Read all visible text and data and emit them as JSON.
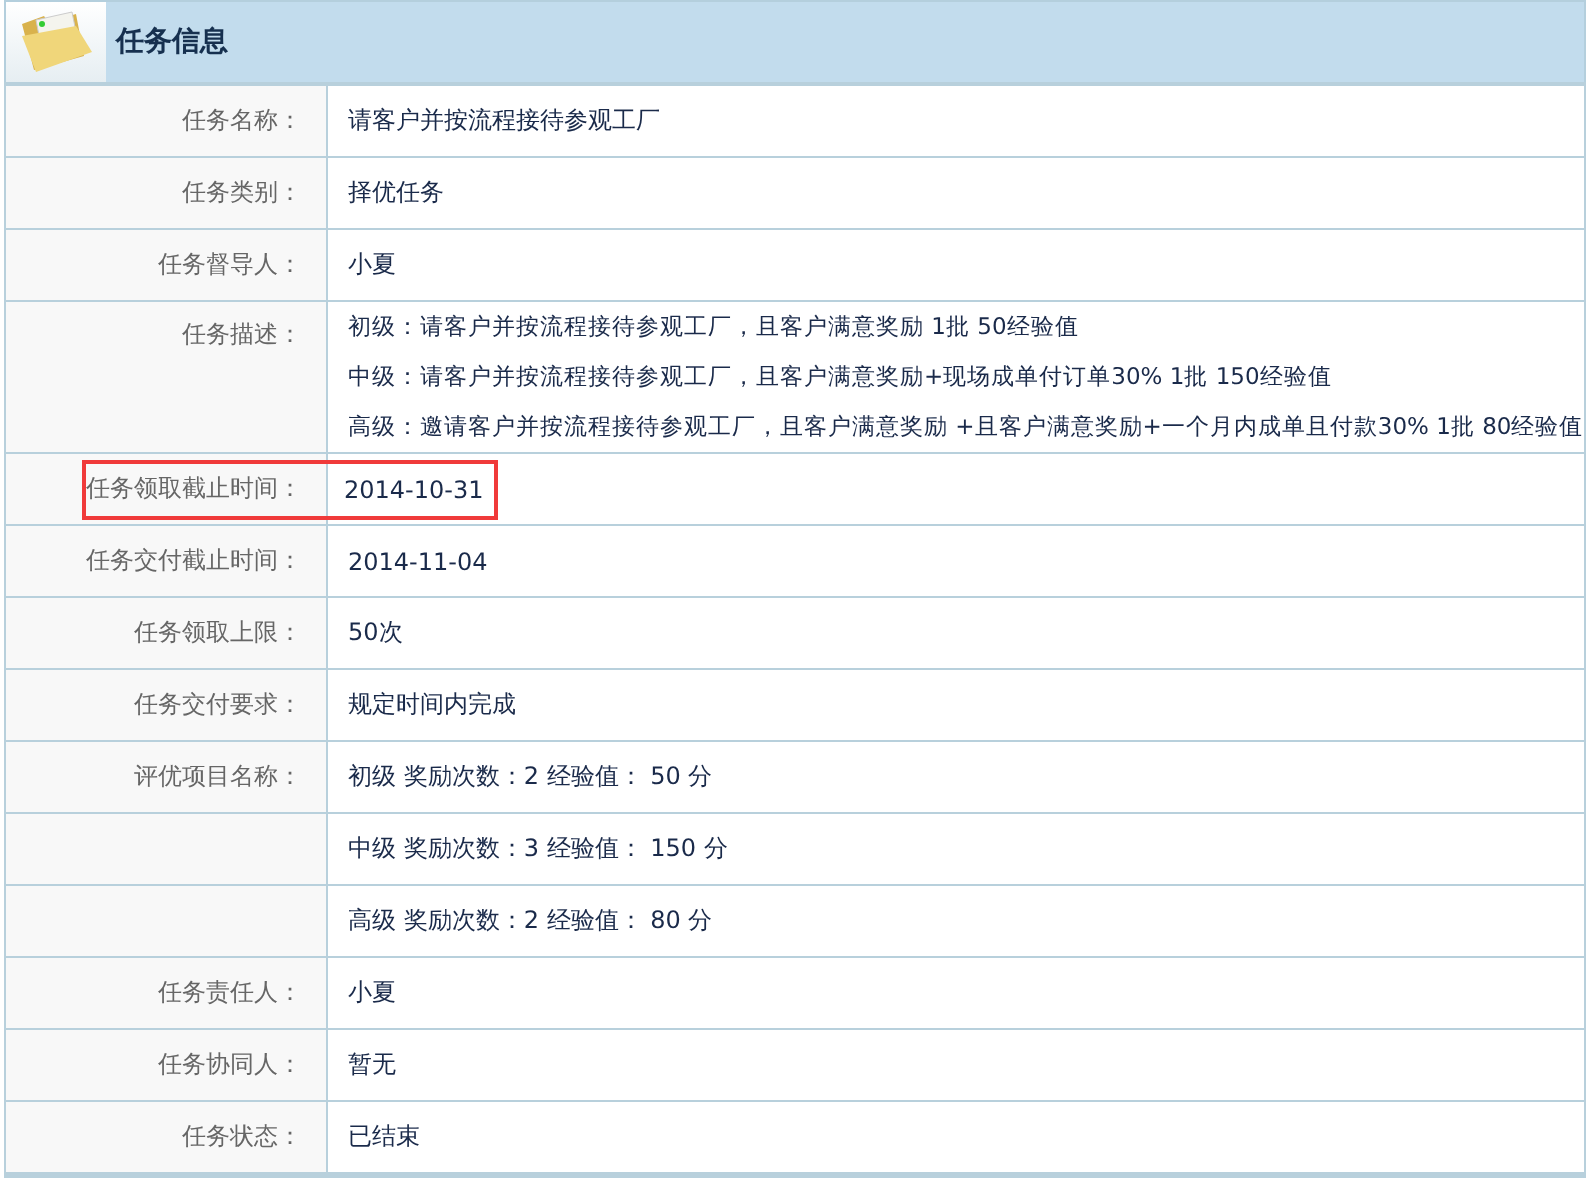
{
  "panel": {
    "title": "任务信息"
  },
  "rows": [
    {
      "label": "任务名称：",
      "value": "请客户并按流程接待参观工厂",
      "highlighted": false
    },
    {
      "label": "任务类别：",
      "value": "择优任务",
      "highlighted": false
    },
    {
      "label": "任务督导人：",
      "value": "小夏",
      "highlighted": false
    },
    {
      "label": "任务描述：",
      "lines": [
        "初级：请客户并按流程接待参观工厂，且客户满意奖励 1批 50经验值",
        "中级：请客户并按流程接待参观工厂，且客户满意奖励+现场成单付订单30% 1批 150经验值",
        "高级：邀请客户并按流程接待参观工厂，且客户满意奖励 +且客户满意奖励+一个月内成单且付款30% 1批 80经验值"
      ],
      "highlighted": false
    },
    {
      "label": "任务领取截止时间：",
      "value": "2014-10-31",
      "highlighted": true
    },
    {
      "label": "任务交付截止时间：",
      "value": "2014-11-04",
      "highlighted": false
    },
    {
      "label": "任务领取上限：",
      "value": "50次",
      "highlighted": false
    },
    {
      "label": "任务交付要求：",
      "value": "规定时间内完成",
      "highlighted": false
    },
    {
      "label": "评优项目名称：",
      "value": "初级 奖励次数：2 经验值：  50 分",
      "highlighted": false
    },
    {
      "value": "中级 奖励次数：3 经验值：  150 分",
      "highlighted": false
    },
    {
      "value": "高级 奖励次数：2 经验值：  80 分",
      "highlighted": false
    },
    {
      "label": "任务责任人：",
      "value": "小夏",
      "highlighted": false
    },
    {
      "label": "任务协同人：",
      "value": "暂无",
      "highlighted": false
    },
    {
      "label": "任务状态：",
      "value": "已结束",
      "highlighted": false
    }
  ]
}
